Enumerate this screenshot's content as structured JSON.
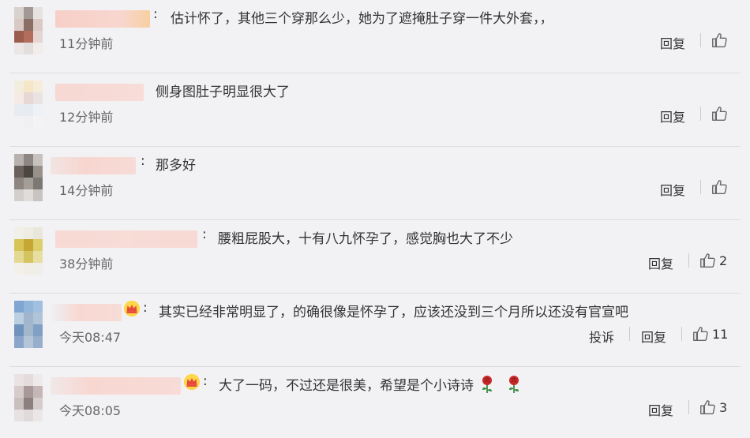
{
  "comments": [
    {
      "text": "估计怀了，其他三个穿那么少，她为了遮掩肚子穿一件大外套，，",
      "time": "11分钟前",
      "reply": "回复",
      "likes": "",
      "avatar_colors": [
        "#d9d2cf",
        "#a49893",
        "#e7e2e0",
        "#d9c9c4",
        "#8e6e65",
        "#dcc9c4",
        "#a05c4a",
        "#b86c5a",
        "#e7d6d2",
        "#ede6e4",
        "#e3dede",
        "#f2ecea"
      ],
      "nick_color": "#f6cfc8"
    },
    {
      "text": "侧身图肚子明显很大了",
      "time": "12分钟前",
      "reply": "回复",
      "likes": "",
      "avatar_colors": [
        "#f3eedc",
        "#f7e6c5",
        "#f6edd8",
        "#f5ece3",
        "#e8d8d4",
        "#ece3e2",
        "#e8ecf0",
        "#e6ebf2",
        "#eef2f6",
        "#f2f1f3",
        "#f0eff2",
        "#f3f2f5"
      ],
      "nick_color": "#f7d8d3"
    },
    {
      "text": "那多好",
      "time": "14分钟前",
      "reply": "回复",
      "likes": "",
      "avatar_colors": [
        "#b9b2ad",
        "#8f8681",
        "#c9c2bd",
        "#6b615a",
        "#4d463f",
        "#98908a",
        "#8d857f",
        "#a59e98",
        "#7e7873",
        "#d3cfcc",
        "#e0dcd9",
        "#c7c3c0"
      ],
      "nick_color": "#f7d6d0"
    },
    {
      "text": "腰粗屁股大，十有八九怀孕了，感觉胸也大了不少",
      "time": "38分钟前",
      "reply": "回复",
      "likes": "2",
      "avatar_colors": [
        "#f0efe7",
        "#eeece2",
        "#e9e7da",
        "#d8c64a",
        "#caa72a",
        "#e0cf63",
        "#e5d98c",
        "#d6c454",
        "#e8de9a",
        "#f2f0e8",
        "#f0eee4",
        "#efeee8"
      ],
      "nick_color": "#f8d9d3"
    },
    {
      "text": "其实已经非常明显了，的确很像是怀孕了，应该还没到三个月所以还没有官宣吧",
      "time": "今天08:47",
      "report": "投诉",
      "reply": "回复",
      "likes": "11",
      "avatar_colors": [
        "#7aa7d6",
        "#8fb6df",
        "#9ec0e4",
        "#b9cfe6",
        "#9fb6cf",
        "#aec4da",
        "#6d93c2",
        "#a1b7cf",
        "#7c9fca",
        "#86a5cf",
        "#b4c5da",
        "#95aed0"
      ],
      "nick_color": "#f8d8d2"
    },
    {
      "text": "大了一码，不过还是很美，希望是个小诗诗",
      "time": "今天08:05",
      "reply": "回复",
      "likes": "3",
      "avatar_colors": [
        "#eae3e3",
        "#e5dcdc",
        "#efeaea",
        "#d7cccc",
        "#a99898",
        "#c7b7b7",
        "#c9bfbf",
        "#8f7f7f",
        "#d6cccc",
        "#e7e1e1",
        "#e2dada",
        "#ece7e7"
      ],
      "nick_color": "#f8d7d1"
    }
  ]
}
